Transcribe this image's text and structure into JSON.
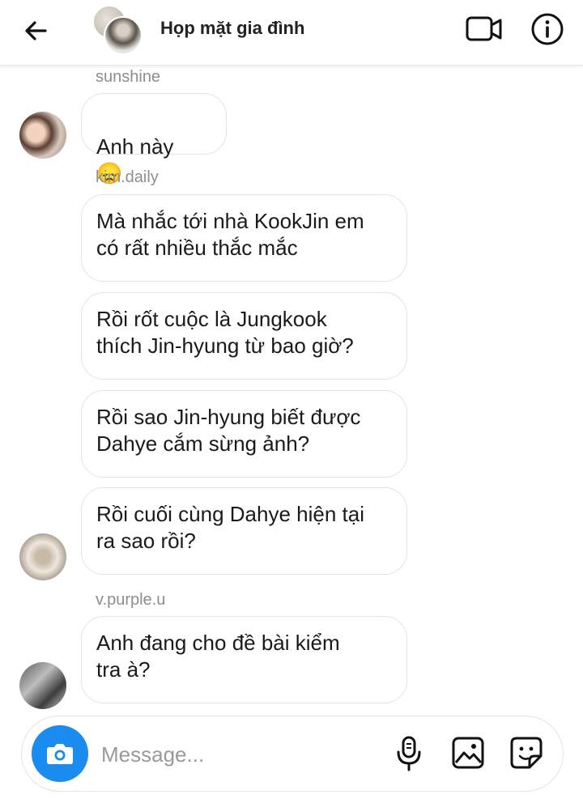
{
  "header": {
    "title": "Họp mặt gia đình",
    "icons": [
      "back-arrow-icon",
      "group-avatar",
      "video-call-icon",
      "info-icon"
    ]
  },
  "messages": [
    {
      "sender": "sunshine",
      "text": "Anh này",
      "emoji": "😞"
    },
    {
      "sender": "kim.daily",
      "text": "Mà nhắc tới nhà KookJin em\ncó rất nhiều thắc mắc"
    },
    {
      "text": "Rồi rốt cuộc là Jungkook\nthích Jin-hyung từ bao giờ?"
    },
    {
      "text": "Rồi sao Jin-hyung biết được\nDahye cắm sừng ảnh?"
    },
    {
      "text": "Rồi cuối cùng Dahye hiện tại\nra sao rồi?"
    },
    {
      "sender": "v.purple.u",
      "text": "Anh đang cho đề bài kiểm\ntra à?"
    }
  ],
  "composer": {
    "placeholder": "Message...",
    "value": "",
    "accent": "#1a8cf0"
  }
}
